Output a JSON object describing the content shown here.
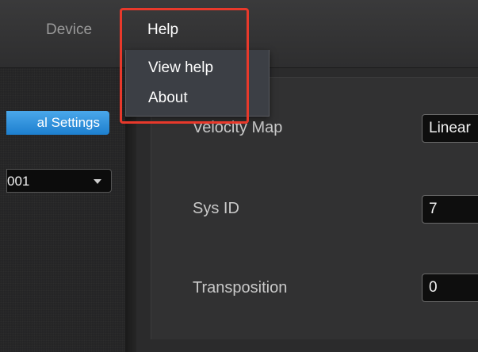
{
  "menubar": {
    "items": [
      {
        "label": "Device"
      },
      {
        "label": "Help"
      }
    ]
  },
  "help_menu": {
    "items": [
      {
        "label": "View help"
      },
      {
        "label": "About"
      }
    ]
  },
  "sidebar": {
    "active_tab_label": "al Settings",
    "device_select_value": "001"
  },
  "settings": {
    "velocity_map": {
      "label": "Velocity Map",
      "value": "Linear"
    },
    "sys_id": {
      "label": "Sys ID",
      "value": "7"
    },
    "transposition": {
      "label": "Transposition",
      "value": "0"
    }
  },
  "colors": {
    "accent": "#2b8fe0",
    "highlight_annotation": "#e8392b"
  }
}
